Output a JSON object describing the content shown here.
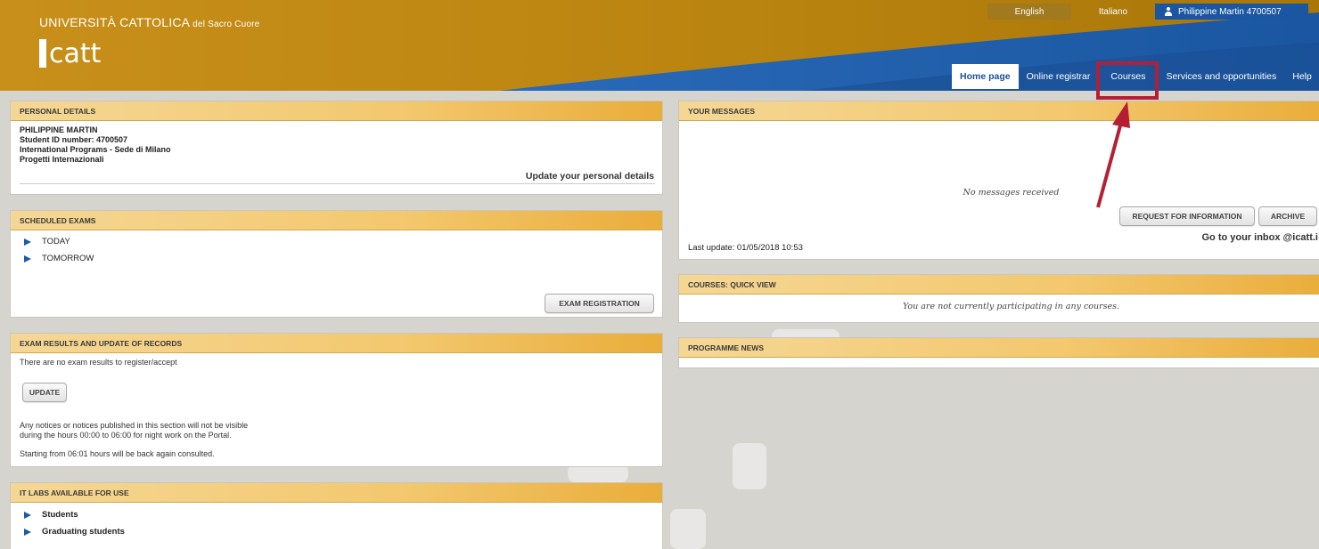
{
  "header": {
    "university_main": "UNIVERSITÀ CATTOLICA",
    "university_sub": " del Sacro Cuore",
    "logo_text": "catt",
    "lang_english": "English",
    "lang_italiano": "Italiano",
    "user_name": "Philippine Martin 4700507"
  },
  "nav": {
    "tabs": [
      {
        "label": "Home page"
      },
      {
        "label": "Online registrar"
      },
      {
        "label": "Courses"
      },
      {
        "label": "Services and opportunities"
      },
      {
        "label": "Help"
      }
    ]
  },
  "personal_details": {
    "title": "PERSONAL DETAILS",
    "name": "PHILIPPINE MARTIN",
    "student_id": "Student ID number: 4700507",
    "program": "International Programs - Sede di Milano",
    "project": "Progetti Internazionali",
    "update_link": "Update your personal details"
  },
  "scheduled_exams": {
    "title": "SCHEDULED EXAMS",
    "items": [
      "TODAY",
      "TOMORROW"
    ],
    "button": "EXAM REGISTRATION"
  },
  "exam_results": {
    "title": "EXAM RESULTS AND UPDATE OF RECORDS",
    "no_results": "There are no exam results to register/accept",
    "button": "UPDATE",
    "notice_line1": "Any notices or notices published in this section will not be visible",
    "notice_line2": "during the hours 00:00 to 06:00 for night work on the Portal.",
    "notice_line3": "Starting from 06:01 hours will be back again consulted."
  },
  "it_labs": {
    "title": "IT LABS AVAILABLE FOR USE",
    "items": [
      "Students",
      "Graduating students"
    ]
  },
  "messages": {
    "title": "YOUR MESSAGES",
    "empty": "No messages received",
    "btn_request": "REQUEST FOR INFORMATION",
    "btn_archive": "ARCHIVE",
    "last_update": "Last update: 01/05/2018 10:53",
    "inbox_link": "Go to your inbox @icatt.i"
  },
  "courses_quick": {
    "title": "COURSES: QUICK VIEW",
    "empty": "You are not currently participating in any courses."
  },
  "programme_news": {
    "title": "PROGRAMME NEWS"
  },
  "colors": {
    "header_gold": "#c08a13",
    "header_blue": "#1a56a1",
    "panel_head": "#f3c86e",
    "arrow_blue": "#1d5aa5",
    "annotation_red": "#b51f35"
  }
}
